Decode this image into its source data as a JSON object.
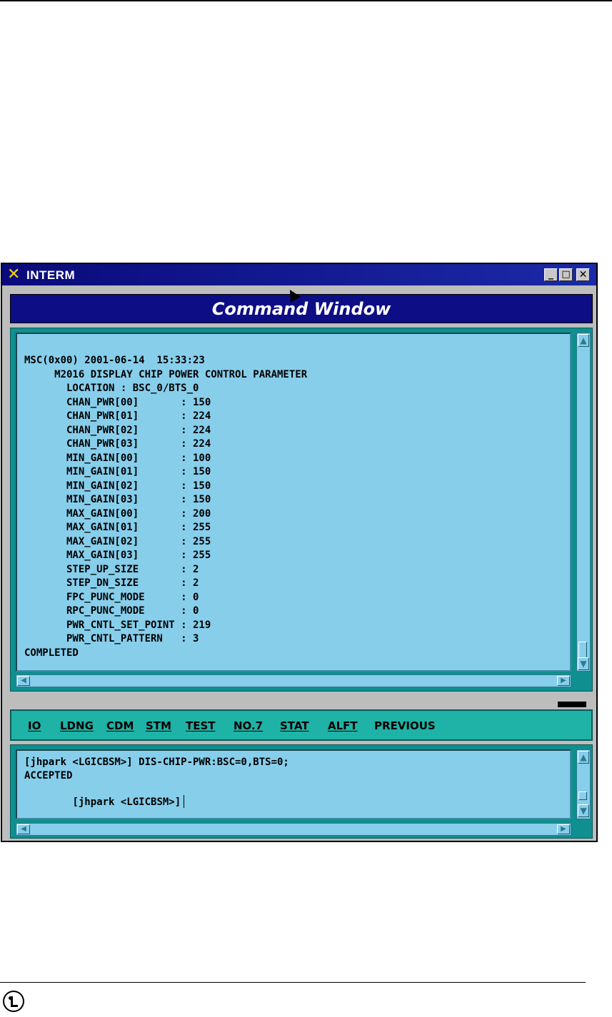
{
  "window": {
    "title": "INTERM",
    "minimize_glyph": "_",
    "maximize_glyph": "□",
    "close_glyph": "✕",
    "app_icon": "x-icon"
  },
  "command_window": {
    "title": "Command Window"
  },
  "output": {
    "lines": [
      "MSC(0x00) 2001-06-14  15:33:23",
      "     M2016 DISPLAY CHIP POWER CONTROL PARAMETER",
      "       LOCATION : BSC_0/BTS_0",
      "       CHAN_PWR[00]       : 150",
      "       CHAN_PWR[01]       : 224",
      "       CHAN_PWR[02]       : 224",
      "       CHAN_PWR[03]       : 224",
      "       MIN_GAIN[00]       : 100",
      "       MIN_GAIN[01]       : 150",
      "       MIN_GAIN[02]       : 150",
      "       MIN_GAIN[03]       : 150",
      "       MAX_GAIN[00]       : 200",
      "       MAX_GAIN[01]       : 255",
      "       MAX_GAIN[02]       : 255",
      "       MAX_GAIN[03]       : 255",
      "       STEP_UP_SIZE       : 2",
      "       STEP_DN_SIZE       : 2",
      "       FPC_PUNC_MODE      : 0",
      "       RPC_PUNC_MODE      : 0",
      "       PWR_CNTL_SET_POINT : 219",
      "       PWR_CNTL_PATTERN   : 3",
      "COMPLETED"
    ]
  },
  "menu": {
    "items": [
      "IO",
      "LDNG",
      "CDM",
      "STM",
      "TEST",
      "NO.7",
      "STAT",
      "ALFT",
      "PREVIOUS"
    ]
  },
  "input": {
    "lines": [
      "[jhpark <LGICBSM>] DIS-CHIP-PWR:BSC=0,BTS=0;",
      "ACCEPTED",
      "[jhpark <LGICBSM>]"
    ]
  },
  "colors": {
    "titlebar": "#0a0a7a",
    "text_area": "#87ceeb",
    "menu_bar": "#1fb2a6",
    "frame": "#0f8f8f"
  }
}
